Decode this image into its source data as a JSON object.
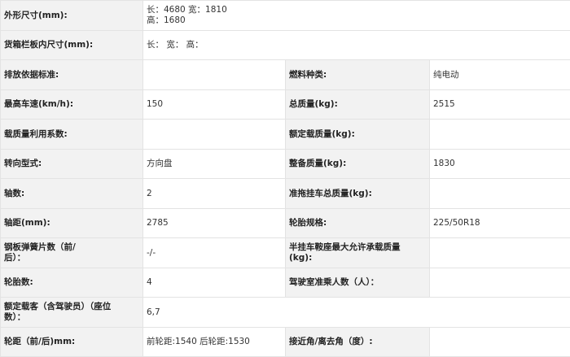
{
  "rows": [
    {
      "label": "外形尺寸(mm):",
      "value": "长：4680 宽：1810 高：1680",
      "span": true
    },
    {
      "label": "货箱栏板内尺寸(mm):",
      "value": "长： 宽： 高：",
      "span": true
    },
    {
      "label": "排放依据标准:",
      "value": "",
      "label2": "燃料种类:",
      "value2": "纯电动"
    },
    {
      "label": "最高车速(km/h):",
      "value": "150",
      "label2": "总质量(kg):",
      "value2": "2515"
    },
    {
      "label": "载质量利用系数:",
      "value": "",
      "label2": "额定载质量(kg):",
      "value2": ""
    },
    {
      "label": "转向型式:",
      "value": "方向盘",
      "label2": "整备质量(kg):",
      "value2": "1830"
    },
    {
      "label": "轴数:",
      "value": "2",
      "label2": "准拖挂车总质量(kg):",
      "value2": ""
    },
    {
      "label": "轴距(mm):",
      "value": "2785",
      "label2": "轮胎规格:",
      "value2": "225/50R18"
    },
    {
      "label": "钢板弹簧片数（前/后）：",
      "value": "-/-",
      "label2": "半挂车鞍座最大允许承载质量(kg):",
      "value2": ""
    },
    {
      "label": "轮胎数:",
      "value": "4",
      "label2": "驾驶室准乘人数（人）：",
      "value2": ""
    },
    {
      "label": "额定载客（含驾驶员）（座位数）：",
      "value": "6,7",
      "span": true
    },
    {
      "label": "轮距（前/后)mm:",
      "value": "前轮距:1540 后轮距:1530",
      "label2": "接近角/离去角（度）:",
      "value2": ""
    }
  ]
}
